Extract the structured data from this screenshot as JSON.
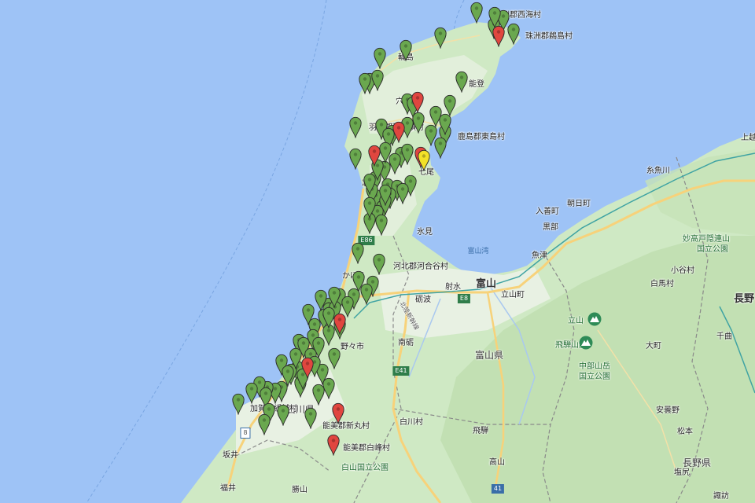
{
  "colors": {
    "sea": "#9ec3f6",
    "land": "#cfe9c4",
    "plain": "#e8f1e3",
    "mountain": "#bcdcad",
    "pin_green": "#6aa84f",
    "pin_red": "#e0463f",
    "pin_yellow": "#f2e128",
    "road": "#f7d27a",
    "border": "#8a8a8a"
  },
  "labels": {
    "suzu_nishiumi": "珠洲郡西海村",
    "suzu_hotojima": "珠洲郡鵜島村",
    "wajima": "輪島",
    "noto": "能登",
    "anamizu": "穴水",
    "hakui_nishihozumi": "羽咋郡西穂積村",
    "kashima_higashijima": "鹿島郡東島村",
    "nanao": "七尾",
    "shika": "志賀",
    "himi": "氷見",
    "toyama_bay": "富山湾",
    "kahoku_kawaigaya": "河北郡河合谷村",
    "kahoku": "かほく",
    "toyama": "富山",
    "imizu": "射水",
    "tonami": "砺波",
    "tateyama_town": "立山町",
    "nanto": "南砺",
    "nonoichi": "野々市",
    "ishikawa_pref": "石川県",
    "kaga_kamiiyo": "加賀郡緩越村",
    "nomi_shinmaru": "能美郡新丸村",
    "nomi_shiramine": "能美郡白峰村",
    "shirakawa": "白川村",
    "toyama_pref": "富山県",
    "hakusan_park": "白山国立公園",
    "hida": "飛騨",
    "takayama": "高山",
    "sakai": "坂井",
    "fukui": "福井",
    "katsuyama": "勝山",
    "tateyama_mtn": "立山",
    "hida_range": "飛騨山脈",
    "chubu_park": "中部山岳\n国立公園",
    "myoko_park": "妙高戸隠連山\n国立公園",
    "itoigawa": "糸魚川",
    "asahi": "朝日町",
    "nyuzen": "入善町",
    "kurobe": "黒部",
    "uozu": "魚津",
    "otari": "小谷村",
    "hakuba": "白馬村",
    "nagano_city": "長野",
    "chikuma": "千曲",
    "omachi": "大町",
    "azumino": "安曇野",
    "matsumoto": "松本",
    "nagano_pref": "長野県",
    "shiojiri": "塩尻",
    "suwa": "諏訪",
    "E8": "E8",
    "E41": "E41",
    "E86": "E86",
    "route8": "8",
    "route41": "41",
    "line_jouetsu": "北陸新幹線",
    "extra_jouetsu": "上越"
  },
  "pins": {
    "green_count": 96,
    "red_count": 9,
    "yellow_count": 1
  }
}
